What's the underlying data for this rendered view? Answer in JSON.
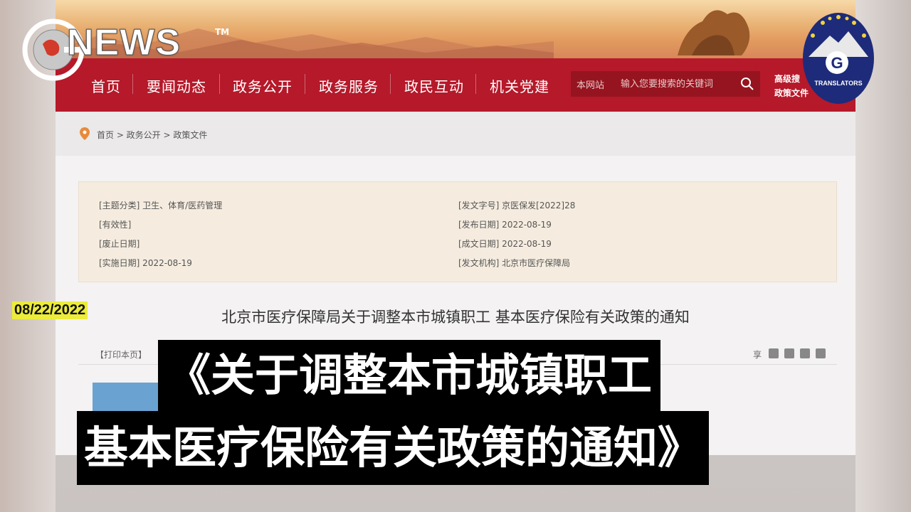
{
  "brand": {
    "name": "NEWS",
    "tm": "TM",
    "badge_text": "TRANSLATORS",
    "badge_letter": "G"
  },
  "date": "08/22/2022",
  "nav": {
    "items": [
      "首页",
      "要闻动态",
      "政务公开",
      "政务服务",
      "政民互动",
      "机关党建"
    ],
    "search_scope": "本网站",
    "search_placeholder": "输入您要搜索的关键词",
    "advanced_search": "高级搜",
    "policy_files": "政策文件"
  },
  "breadcrumb": "首页 > 政务公开 > 政策文件",
  "info": {
    "topic": "[主题分类]  卫生、体育/医药管理",
    "validity": "[有效性]",
    "repeal_date": "[废止日期]",
    "effective_date": "[实施日期]  2022-08-19",
    "doc_number": "[发文字号]  京医保发[2022]28",
    "publish_date": "[发布日期]  2022-08-19",
    "written_date": "[成文日期]  2022-08-19",
    "issuer": "[发文机构]  北京市医疗保障局"
  },
  "doc_title": "北京市医疗保障局关于调整本市城镇职工 基本医疗保险有关政策的通知",
  "print_label": "【打印本页】",
  "share_label": "享",
  "subtitle": {
    "line1": "《关于调整本市城镇职工",
    "line2": "基本医疗保险有关政策的通知》"
  },
  "colors": {
    "nav_red": "#b5192a",
    "info_bg": "#f5ecdf",
    "date_tag": "#ecec3a"
  }
}
